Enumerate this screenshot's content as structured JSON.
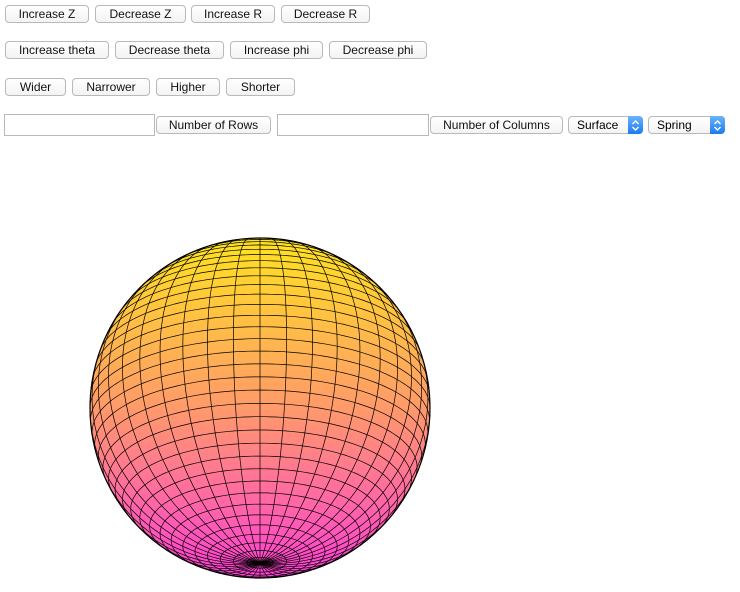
{
  "toolbar": {
    "row1": [
      "Increase Z",
      "Decrease Z",
      "Increase R",
      "Decrease R"
    ],
    "row2": [
      "Increase theta",
      "Decrease theta",
      "Increase phi",
      "Decrease phi"
    ],
    "row3": [
      "Wider",
      "Narrower",
      "Higher",
      "Shorter"
    ]
  },
  "controls": {
    "rows_input_value": "",
    "rows_button": "Number of Rows",
    "columns_input_value": "",
    "columns_button": "Number of Columns",
    "plot_type_selected": "Surface",
    "colormap_selected": "Spring"
  },
  "plot": {
    "shape": "sphere",
    "latitude_bands": 40,
    "longitude_lines": 40,
    "colormap": "spring",
    "gradient_colors": [
      "#ffe320",
      "#ff9a6a",
      "#ff3ed6"
    ],
    "mesh_color": "#000000"
  }
}
